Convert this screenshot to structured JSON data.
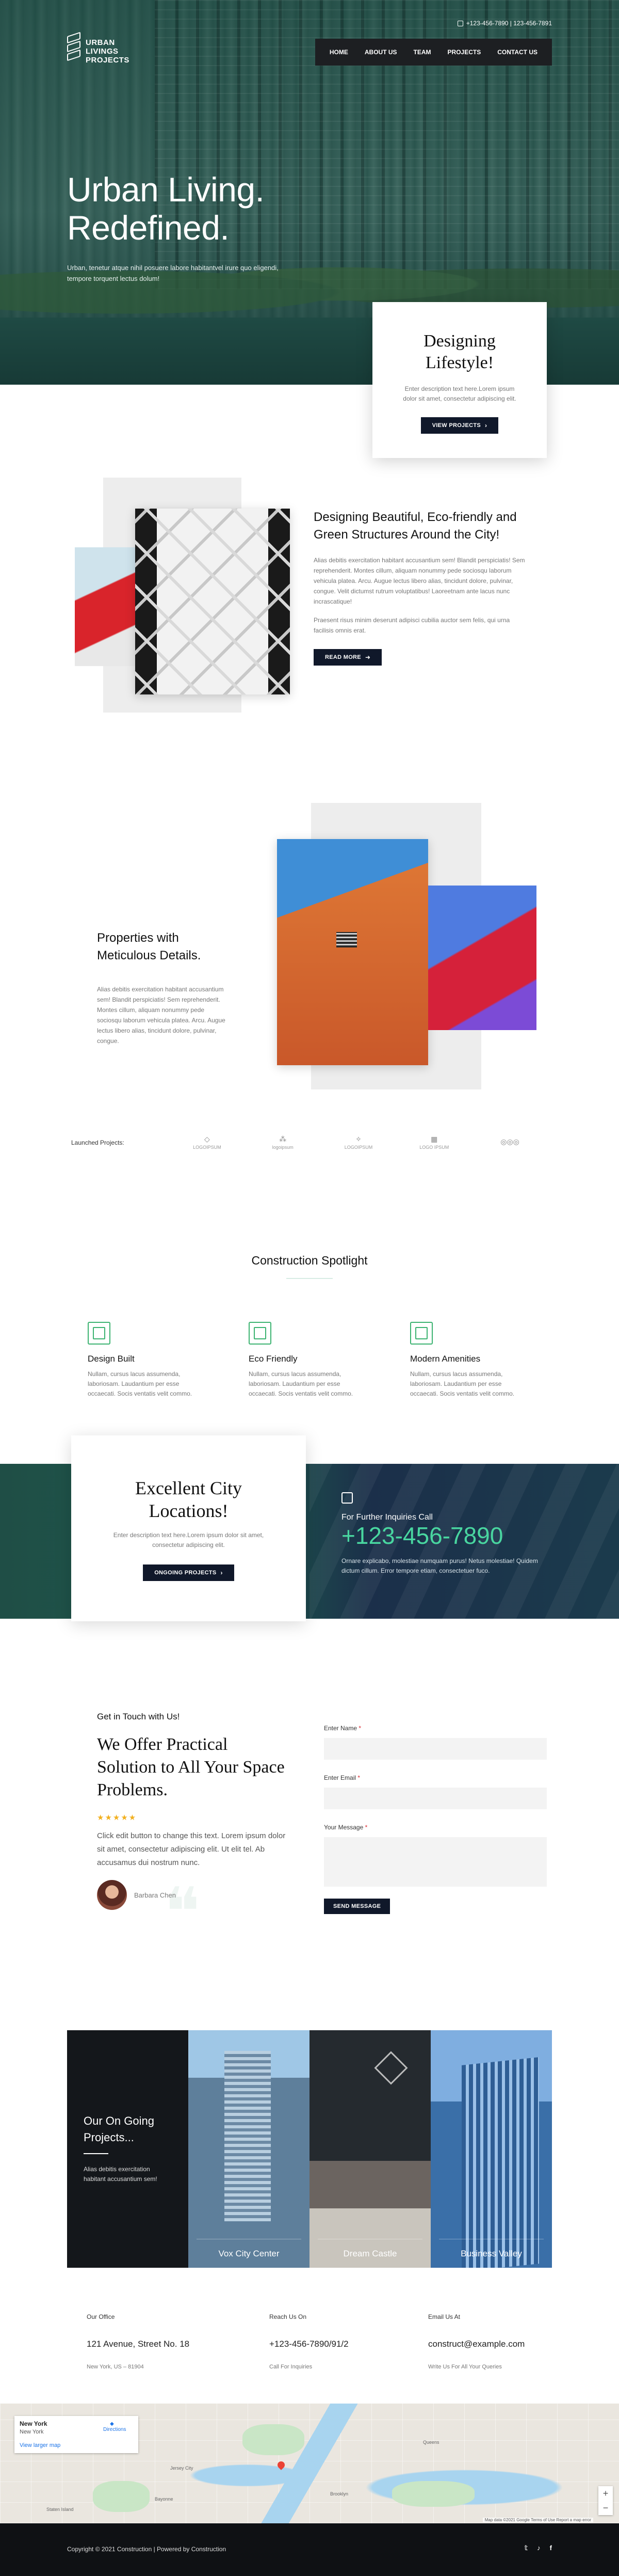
{
  "brand": {
    "logo_line1": "URBAN",
    "logo_line2": "LIVINGS",
    "logo_line3": "PROJECTS"
  },
  "topbar": {
    "phones": "+123-456-7890 | 123-456-7891"
  },
  "nav": {
    "items": [
      "HOME",
      "ABOUT US",
      "TEAM",
      "PROJECTS",
      "CONTACT US"
    ]
  },
  "hero": {
    "title_line1": "Urban Living.",
    "title_line2": "Redefined.",
    "subtitle": "Urban, tenetur atque nihil posuere labore habitantvel irure quo eligendi, tempore torquent lectus dolum!"
  },
  "hero_card": {
    "title_line1": "Designing",
    "title_line2": "Lifestyle!",
    "text": "Enter description text here.Lorem ipsum dolor sit amet, consectetur adipiscing elit.",
    "button": "VIEW PROJECTS"
  },
  "eco": {
    "title": "Designing Beautiful, Eco-friendly and Green Structures Around the City!",
    "para1": "Alias debitis exercitation habitant accusantium sem! Blandit perspiciatis! Sem reprehenderit. Montes cillum, aliquam nonummy pede sociosqu laborum vehicula platea. Arcu. Augue lectus libero alias, tincidunt dolore, pulvinar, congue. Velit dictumst rutrum voluptatibus! Laoreetnam ante lacus nunc incrascatique!",
    "para2": "Praesent risus minim deserunt adipisci cubilia auctor sem felis, qui urna facilisis omnis erat.",
    "button": "READ MORE"
  },
  "properties": {
    "title": "Properties with Meticulous Details.",
    "text": "Alias debitis exercitation habitant accusantium sem! Blandit perspiciatis! Sem reprehenderit. Montes cillum, aliquam nonummy pede sociosqu laborum vehicula platea. Arcu. Augue lectus libero alias, tincidunt dolore, pulvinar, congue."
  },
  "launched": {
    "label": "Launched Projects:",
    "logos": [
      {
        "glyph": "◇",
        "name": "LOGOIPSUM"
      },
      {
        "glyph": "⁂",
        "name": "logoipsum"
      },
      {
        "glyph": "✧",
        "name": "LOGOIPSUM"
      },
      {
        "glyph": "▦",
        "name": "LOGO IPSUM"
      },
      {
        "glyph": "◎◎◎",
        "name": ""
      }
    ]
  },
  "spotlight": {
    "title": "Construction Spotlight",
    "features": [
      {
        "title": "Design Built",
        "text": "Nullam, cursus lacus assumenda, laboriosam. Laudantium per esse occaecati. Socis ventatis velit commo."
      },
      {
        "title": "Eco Friendly",
        "text": "Nullam, cursus lacus assumenda, laboriosam. Laudantium per esse occaecati. Socis ventatis velit commo."
      },
      {
        "title": "Modern Amenities",
        "text": "Nullam, cursus lacus assumenda, laboriosam. Laudantium per esse occaecati. Socis ventatis velit commo."
      }
    ]
  },
  "cta": {
    "title_line1": "Excellent City",
    "title_line2": "Locations!",
    "text": "Enter description text here.Lorem ipsum dolor sit amet, consectetur adipiscing elit.",
    "button": "ONGOING PROJECTS",
    "inquiry_label": "For Further Inquiries Call",
    "phone": "+123-456-7890",
    "info_text": "Ornare explicabo, molestiae numquam purus! Netus molestiae! Quidem dictum cillum. Error tempore etiam, consectetuer fuco."
  },
  "contact": {
    "kicker": "Get in Touch with Us!",
    "title": "We Offer Practical Solution to All Your Space Problems.",
    "stars": "★★★★★",
    "quote": "Click edit button to change this text. Lorem ipsum dolor sit amet, consectetur adipiscing elit. Ut elit tel. Ab accusamus dui nostrum nunc.",
    "author": "Barbara Chen",
    "form": {
      "name_label": "Enter Name",
      "email_label": "Enter Email",
      "message_label": "Your Message",
      "required_mark": "*",
      "submit": "SEND MESSAGE"
    }
  },
  "projects": {
    "title": "Our On Going Projects...",
    "text": "Alias debitis exercitation habitant accusantium sem!",
    "items": [
      "Vox City Center",
      "Dream Castle",
      "Business Valley"
    ]
  },
  "office": {
    "col1": {
      "label": "Our Office",
      "value": "121 Avenue, Street No. 18",
      "sub": "New York, US – 81904"
    },
    "col2": {
      "label": "Reach Us On",
      "value": "+123-456-7890/91/2",
      "sub": "Call For Inquiries"
    },
    "col3": {
      "label": "Email Us At",
      "value": "construct@example.com",
      "sub": "Write Us For All Your Queries"
    }
  },
  "map": {
    "place": "New York",
    "place_sub": "New York",
    "directions": "Directions",
    "larger_map": "View larger map",
    "attribution": "Map data ©2021 Google   Terms of Use   Report a map error",
    "labels": [
      "Jersey City",
      "Brooklyn",
      "Queens",
      "Staten Island",
      "Bayonne"
    ]
  },
  "footer": {
    "copyright": "Copyright © 2021 Construction | Powered by Construction",
    "social": [
      "𝕥",
      "♪",
      "f"
    ]
  },
  "colors": {
    "accent": "#3cb371",
    "dark_button": "#10182a",
    "phone_green": "#49d6a0"
  }
}
